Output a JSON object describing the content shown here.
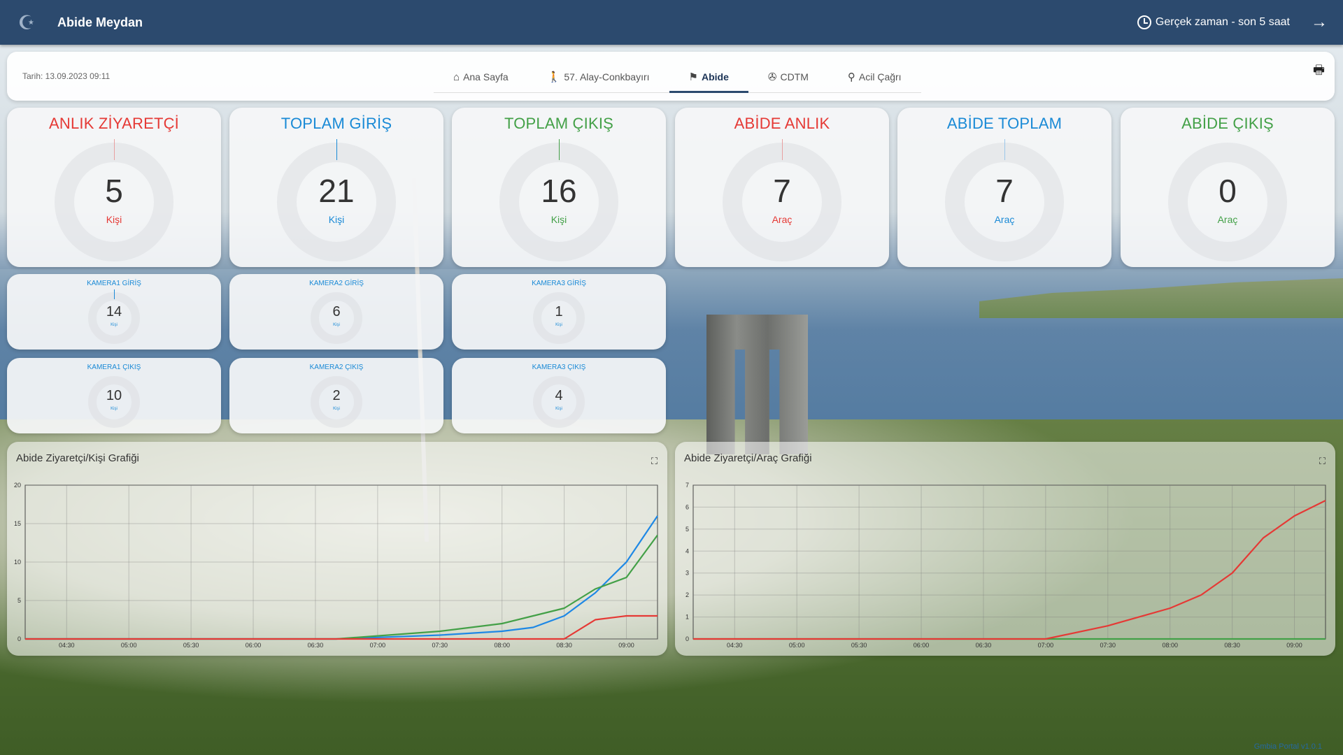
{
  "header": {
    "title": "Abide Meydan",
    "time_range": "Gerçek zaman - son 5 saat"
  },
  "nav": {
    "date": "Tarih: 13.09.2023 09:11",
    "tabs": [
      {
        "label": "Ana Sayfa",
        "icon": "home-icon"
      },
      {
        "label": "57. Alay-Conkbayırı",
        "icon": "hiker-icon"
      },
      {
        "label": "Abide",
        "icon": "flag-icon",
        "active": true
      },
      {
        "label": "CDTM",
        "icon": "aperture-icon"
      },
      {
        "label": "Acil Çağrı",
        "icon": "location-pin-icon"
      }
    ]
  },
  "cards": [
    {
      "title": "ANLIK ZİYARETÇİ",
      "value": "5",
      "unit": "Kişi",
      "color": "#e53935"
    },
    {
      "title": "TOPLAM GİRİŞ",
      "value": "21",
      "unit": "Kişi",
      "color": "#1a8ad6"
    },
    {
      "title": "TOPLAM ÇIKIŞ",
      "value": "16",
      "unit": "Kişi",
      "color": "#43a047"
    },
    {
      "title": "ABİDE ANLIK",
      "value": "7",
      "unit": "Araç",
      "color": "#e53935"
    },
    {
      "title": "ABİDE TOPLAM",
      "value": "7",
      "unit": "Araç",
      "color": "#1a8ad6"
    },
    {
      "title": "ABİDE ÇIKIŞ",
      "value": "0",
      "unit": "Araç",
      "color": "#43a047"
    }
  ],
  "cameras": [
    {
      "title": "KAMERA1 GİRİŞ",
      "value": "14",
      "unit": "Kişi"
    },
    {
      "title": "KAMERA2 GİRİŞ",
      "value": "6",
      "unit": "Kişi"
    },
    {
      "title": "KAMERA3 GİRİŞ",
      "value": "1",
      "unit": "Kişi"
    },
    {
      "title": "KAMERA1 ÇIKIŞ",
      "value": "10",
      "unit": "Kişi"
    },
    {
      "title": "KAMERA2 ÇIKIŞ",
      "value": "2",
      "unit": "Kişi"
    },
    {
      "title": "KAMERA3 ÇIKIŞ",
      "value": "4",
      "unit": "Kişi"
    }
  ],
  "charts": {
    "person_title": "Abide Ziyaretçi/Kişi Grafiği",
    "vehicle_title": "Abide Ziyaretçi/Araç Grafiği"
  },
  "chart_data": [
    {
      "type": "line",
      "title": "Abide Ziyaretçi/Kişi Grafiği",
      "xlim": [
        "04:10",
        "09:15"
      ],
      "ylim": [
        0,
        20
      ],
      "xticks": [
        "04:30",
        "05:00",
        "05:30",
        "06:00",
        "06:30",
        "07:00",
        "07:30",
        "08:00",
        "08:30",
        "09:00"
      ],
      "yticks": [
        0,
        5,
        10,
        15,
        20
      ],
      "grid": true,
      "series": [
        {
          "color": "#1e88e5",
          "x": [
            "04:10",
            "06:40",
            "07:00",
            "07:30",
            "08:00",
            "08:15",
            "08:30",
            "08:45",
            "09:00",
            "09:15"
          ],
          "y": [
            0,
            0,
            0.2,
            0.5,
            1,
            1.5,
            3,
            6,
            10,
            16
          ]
        },
        {
          "color": "#43a047",
          "x": [
            "04:10",
            "06:40",
            "07:00",
            "07:30",
            "08:00",
            "08:15",
            "08:30",
            "08:45",
            "09:00",
            "09:15"
          ],
          "y": [
            0,
            0,
            0.4,
            1,
            2,
            3,
            4,
            6.5,
            8,
            13.5
          ]
        },
        {
          "color": "#e53935",
          "x": [
            "04:10",
            "08:15",
            "08:30",
            "08:45",
            "09:00",
            "09:15"
          ],
          "y": [
            0,
            0,
            0,
            2.5,
            3,
            3
          ]
        }
      ]
    },
    {
      "type": "line",
      "title": "Abide Ziyaretçi/Araç Grafiği",
      "xlim": [
        "04:10",
        "09:15"
      ],
      "ylim": [
        0,
        7
      ],
      "xticks": [
        "04:30",
        "05:00",
        "05:30",
        "06:00",
        "06:30",
        "07:00",
        "07:30",
        "08:00",
        "08:30",
        "09:00"
      ],
      "yticks": [
        0,
        1,
        2,
        3,
        4,
        5,
        6,
        7
      ],
      "grid": true,
      "series": [
        {
          "color": "#43a047",
          "x": [
            "04:10",
            "09:15"
          ],
          "y": [
            0,
            0
          ]
        },
        {
          "color": "#e53935",
          "x": [
            "04:10",
            "06:45",
            "07:00",
            "07:30",
            "07:45",
            "08:00",
            "08:15",
            "08:30",
            "08:45",
            "09:00",
            "09:15"
          ],
          "y": [
            0,
            0,
            0,
            0.6,
            1,
            1.4,
            2,
            3,
            4.6,
            5.6,
            6.3
          ]
        }
      ]
    }
  ],
  "footer": {
    "link": "Gmbia Portal v1.0.1"
  }
}
